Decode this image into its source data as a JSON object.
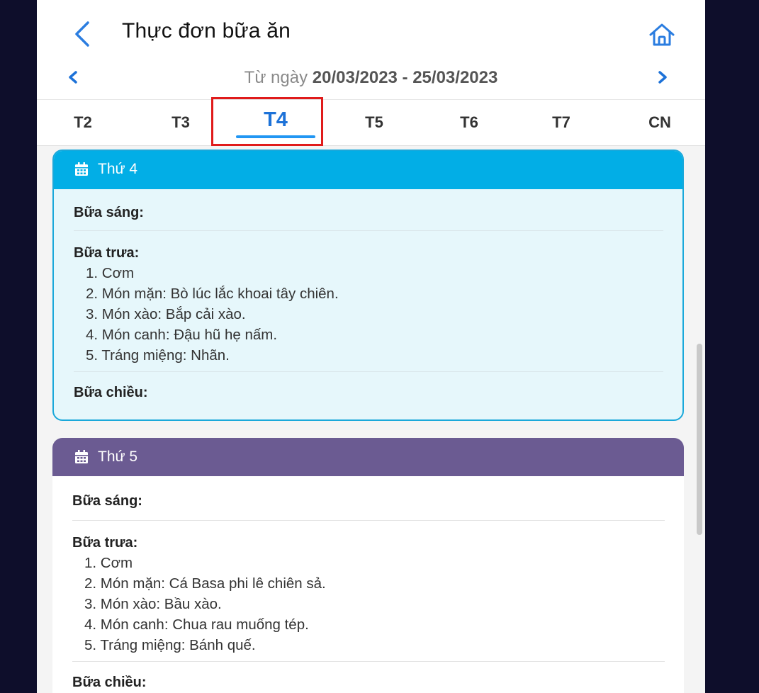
{
  "header": {
    "title": "Thực đơn bữa ăn",
    "date_prefix": "Từ ngày ",
    "date_range": "20/03/2023 - 25/03/2023"
  },
  "tabs": [
    {
      "label": "T2"
    },
    {
      "label": "T3"
    },
    {
      "label": "T4",
      "active": true
    },
    {
      "label": "T5"
    },
    {
      "label": "T6"
    },
    {
      "label": "T7"
    },
    {
      "label": "CN"
    }
  ],
  "colors": {
    "accent": "#1d72d8",
    "highlight_box": "#e01b1b",
    "card1_header": "#02aee6",
    "card2_header": "#6b5b92"
  },
  "icons": [
    "back-arrow-icon",
    "home-icon",
    "chevron-left-icon",
    "chevron-right-icon",
    "calendar-icon"
  ],
  "days": [
    {
      "title": "Thứ 4",
      "breakfast": "Bữa sáng:",
      "lunch": "Bữa trưa:",
      "lunch_items": [
        "1. Cơm",
        "2. Món mặn: Bò lúc lắc khoai tây chiên.",
        "3. Món xào: Bắp cải xào.",
        "4. Món canh: Đậu hũ hẹ nấm.",
        "5. Tráng miệng: Nhãn."
      ],
      "afternoon": "Bữa chiều:"
    },
    {
      "title": "Thứ 5",
      "breakfast": "Bữa sáng:",
      "lunch": "Bữa trưa:",
      "lunch_items": [
        "1. Cơm",
        "2. Món mặn: Cá Basa phi lê chiên sả.",
        "3. Món xào: Bầu xào.",
        "4. Món canh: Chua rau muống tép.",
        "5. Tráng miệng: Bánh quế."
      ],
      "afternoon": "Bữa chiều:"
    }
  ]
}
